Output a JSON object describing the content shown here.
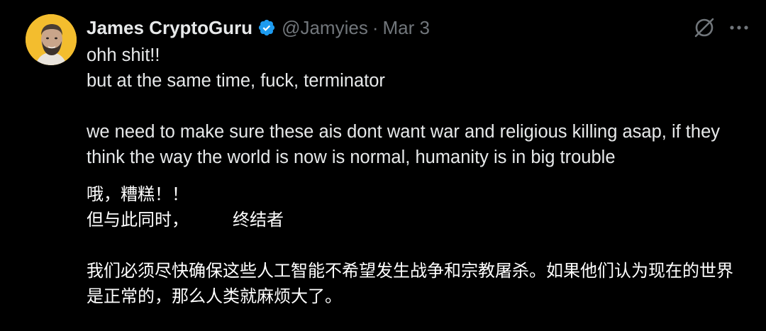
{
  "tweet": {
    "author": {
      "display_name": "James CryptoGuru",
      "handle": "@Jamyies",
      "verified": true,
      "avatar_bg": "#f3bd2e"
    },
    "separator": "·",
    "date": "Mar 3",
    "text_en": {
      "line1": "ohh shit!!",
      "line2": "but at the same time, fuck, terminator",
      "line3": "we need to make sure these ais dont want war and religious killing asap, if they think the way the world is now is normal, humanity is in big trouble"
    },
    "text_zh": {
      "line1": "哦，糟糕！！",
      "line2a": "但与此同时，",
      "line2b": "终结者",
      "line3": "我们必须尽快确保这些人工智能不希望发生战争和宗教屠杀。如果他们认为现在的世界是正常的，那么人类就麻烦大了。"
    }
  },
  "icons": {
    "verified": "verified-badge-icon",
    "grok": "grok-icon",
    "more": "more-horizontal-icon"
  },
  "colors": {
    "background": "#000000",
    "primary_text": "#e7e9ea",
    "secondary_text": "#71767b",
    "verified_blue": "#1d9bf0"
  }
}
